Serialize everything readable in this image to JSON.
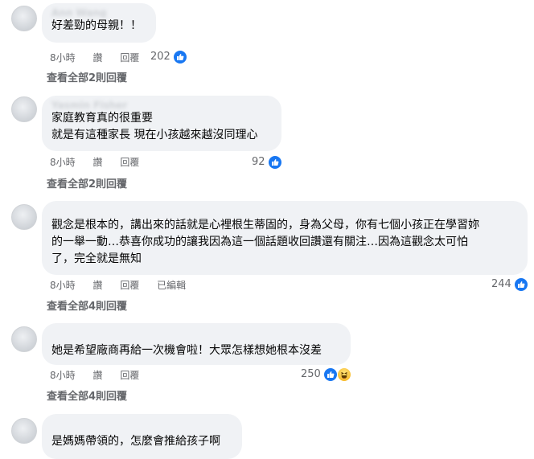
{
  "comments": [
    {
      "author": "Ann Wang",
      "lines": [
        "好差勁的母親！！"
      ],
      "time": "8小時",
      "like_label": "讚",
      "reply_label": "回覆",
      "edited_label": "",
      "reaction_count": "202",
      "reactions": [
        "like-icon"
      ],
      "view_all": "查看全部2則回覆"
    },
    {
      "author": "Yasmin Fisher",
      "lines": [
        "家庭教育真的很重要",
        "就是有這種家長 現在小孩越來越沒同理心"
      ],
      "time": "8小時",
      "like_label": "讚",
      "reply_label": "回覆",
      "edited_label": "",
      "reaction_count": "92",
      "reactions": [
        "like-icon"
      ],
      "view_all": "查看全部2則回覆"
    },
    {
      "author": "",
      "lines": [
        "觀念是根本的，講出來的話就是心裡根生蒂固的，身為父母，你有七個小孩正在學習妳",
        "的一舉一動…恭喜你成功的讓我因為這一個話題收回讚還有關注…因為這觀念太可怕",
        "了，完全就是無知"
      ],
      "time": "8小時",
      "like_label": "讚",
      "reply_label": "回覆",
      "edited_label": "已編輯",
      "reaction_count": "244",
      "reactions": [
        "like-icon"
      ],
      "view_all": "查看全部4則回覆"
    },
    {
      "author": "",
      "lines": [
        "她是希望廠商再給一次機會啦！大眾怎樣想她根本沒差"
      ],
      "time": "8小時",
      "like_label": "讚",
      "reply_label": "回覆",
      "edited_label": "",
      "reaction_count": "250",
      "reactions": [
        "like-icon",
        "haha-icon"
      ],
      "view_all": "查看全部4則回覆"
    },
    {
      "author": "",
      "lines": [
        "是媽媽帶領的，怎麼會推給孩子啊"
      ],
      "time": "",
      "like_label": "",
      "reply_label": "",
      "edited_label": "",
      "reaction_count": "",
      "reactions": [],
      "view_all": ""
    }
  ],
  "colors": {
    "bubble": "#f0f2f5",
    "meta_text": "#65676b",
    "like_blue": "#1877f2",
    "haha_yellow": "#f7b928"
  }
}
